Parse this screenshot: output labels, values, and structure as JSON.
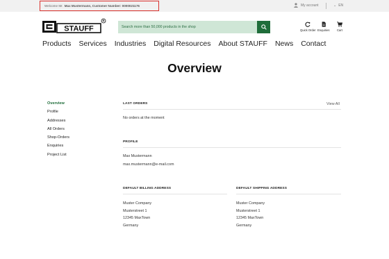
{
  "topbar": {
    "welcome_prefix": "Welcome Mr.",
    "welcome_name": "Max Mustermann, Customer Number: 0000021176",
    "my_account": "My account",
    "language": "EN"
  },
  "header": {
    "logo_text": "STAUFF",
    "search_placeholder": "Search more than 50,000 products in the shop",
    "tools": [
      {
        "label": "Quick Order",
        "icon": "quick-order-icon"
      },
      {
        "label": "Enquiries",
        "icon": "document-icon"
      },
      {
        "label": "Cart",
        "icon": "cart-icon"
      }
    ]
  },
  "mainnav": [
    "Products",
    "Services",
    "Industries",
    "Digital Resources",
    "About STAUFF",
    "News",
    "Contact"
  ],
  "page": {
    "title": "Overview"
  },
  "sidenav": [
    "Overview",
    "Profile",
    "Addresses",
    "All Orders",
    "Shop-Orders",
    "Enquiries",
    "Project List"
  ],
  "orders": {
    "title": "LAST ORDERS",
    "view_all": "View All",
    "empty": "No orders at the moment"
  },
  "profile": {
    "title": "PROFILE",
    "name": "Max Mustermann",
    "email": "max.mustermann@e-mail.com"
  },
  "billing": {
    "title": "DEFAULT BILLING ADDRESS",
    "lines": [
      "Muster Company",
      "Musterstreet 1",
      "12345 MaxTown",
      "Germany"
    ]
  },
  "shipping": {
    "title": "DEFAULT SHIPPING ADDRESS",
    "lines": [
      "Muster Company",
      "Musterstreet 1",
      "12345 MaxTown",
      "Germany"
    ]
  },
  "colors": {
    "brand_green": "#1f6d3a",
    "search_bg": "#cfe6d6",
    "highlight_border": "#d9302c"
  }
}
